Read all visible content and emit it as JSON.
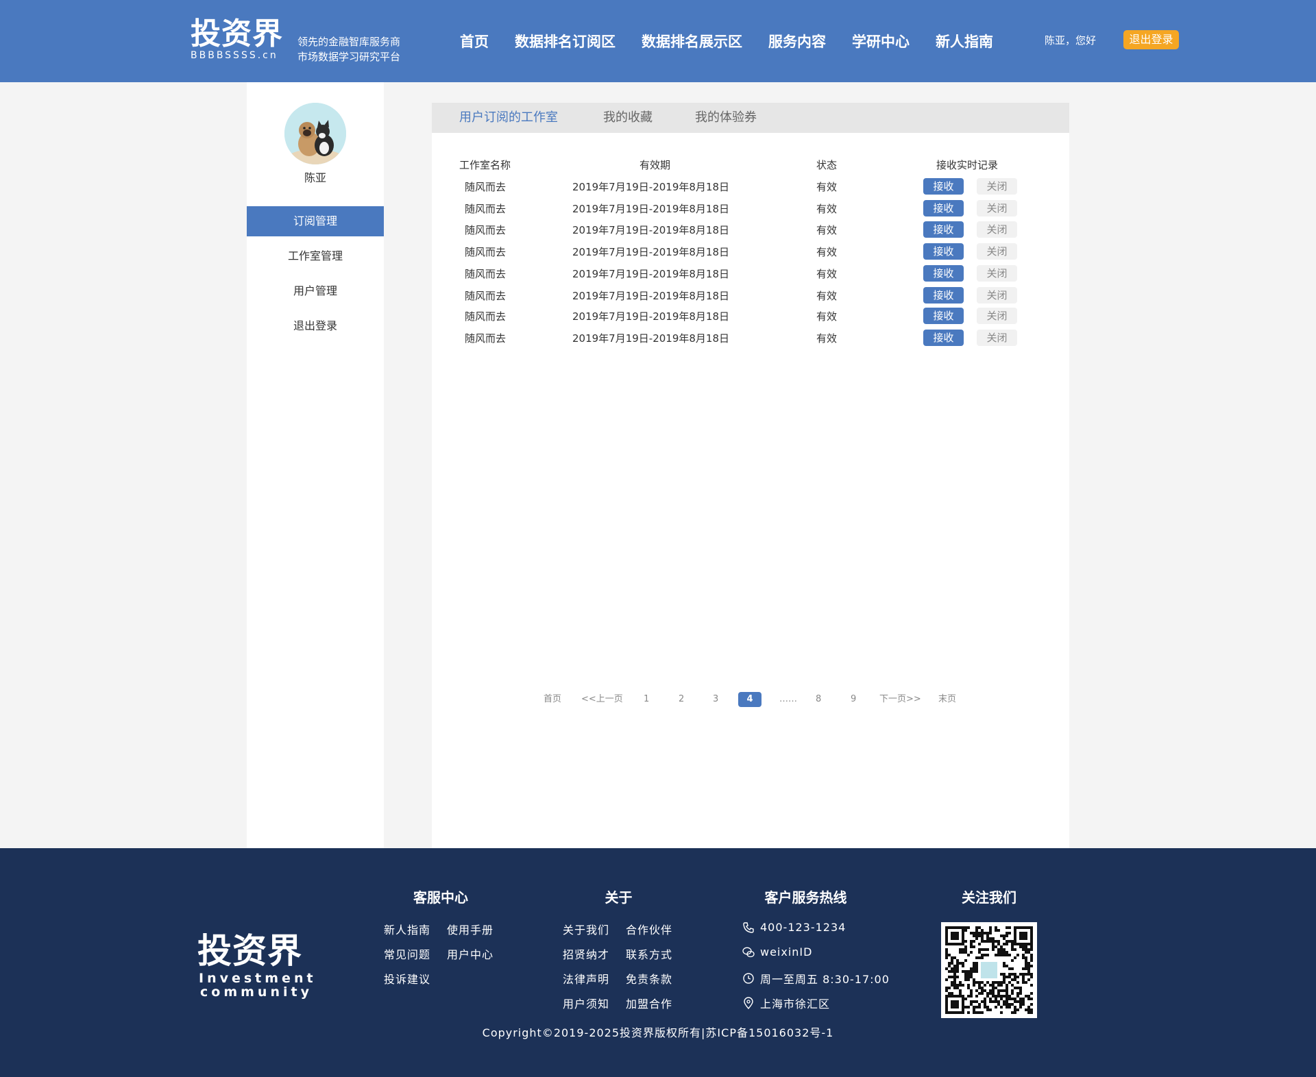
{
  "header": {
    "logo": "投资界",
    "logo_domain": "BBBBSSSS.cn",
    "slogan_line1": "领先的金融智库服务商",
    "slogan_line2": "市场数据学习研究平台",
    "nav": [
      "首页",
      "数据排名订阅区",
      "数据排名展示区",
      "服务内容",
      "学研中心",
      "新人指南"
    ],
    "greeting": "陈亚，您好",
    "logout": "退出登录",
    "colors": {
      "bar": "#4a79bf",
      "logout": "#f5a623"
    }
  },
  "sidebar": {
    "user_name": "陈亚",
    "avatar_icon": "avatar-dog-cat",
    "menu": [
      "订阅管理",
      "工作室管理",
      "用户管理",
      "退出登录"
    ],
    "active_index": 0
  },
  "tabs": [
    "用户订阅的工作室",
    "我的收藏",
    "我的体验券"
  ],
  "table": {
    "headers": [
      "工作室名称",
      "有效期",
      "状态",
      "接收实时记录"
    ],
    "rows": [
      {
        "name": "随风而去",
        "period": "2019年7月19日-2019年8月18日",
        "status": "有效",
        "receive": "接收",
        "close": "关闭"
      },
      {
        "name": "随风而去",
        "period": "2019年7月19日-2019年8月18日",
        "status": "有效",
        "receive": "接收",
        "close": "关闭"
      },
      {
        "name": "随风而去",
        "period": "2019年7月19日-2019年8月18日",
        "status": "有效",
        "receive": "接收",
        "close": "关闭"
      },
      {
        "name": "随风而去",
        "period": "2019年7月19日-2019年8月18日",
        "status": "有效",
        "receive": "接收",
        "close": "关闭"
      },
      {
        "name": "随风而去",
        "period": "2019年7月19日-2019年8月18日",
        "status": "有效",
        "receive": "接收",
        "close": "关闭"
      },
      {
        "name": "随风而去",
        "period": "2019年7月19日-2019年8月18日",
        "status": "有效",
        "receive": "接收",
        "close": "关闭"
      },
      {
        "name": "随风而去",
        "period": "2019年7月19日-2019年8月18日",
        "status": "有效",
        "receive": "接收",
        "close": "关闭"
      },
      {
        "name": "随风而去",
        "period": "2019年7月19日-2019年8月18日",
        "status": "有效",
        "receive": "接收",
        "close": "关闭"
      }
    ]
  },
  "pagination": {
    "first": "首页",
    "prev": "<<上一页",
    "pages": [
      "1",
      "2",
      "3",
      "4",
      "……",
      "8",
      "9"
    ],
    "current": "4",
    "next": "下一页>>",
    "last": "末页"
  },
  "footer": {
    "logo": "投资界",
    "logo_en_line1": "Investment",
    "logo_en_line2": "community",
    "service_title": "客服中心",
    "service_links": [
      "新人指南",
      "使用手册",
      "常见问题",
      "用户中心",
      "投诉建议"
    ],
    "about_title": "关于",
    "about_links": [
      "关于我们",
      "合作伙伴",
      "招贤纳才",
      "联系方式",
      "法律声明",
      "免责条款",
      "用户须知",
      "加盟合作"
    ],
    "hotline_title": "客户服务热线",
    "phone": "400-123-1234",
    "wechat": "weixinID",
    "hours": "周一至周五 8:30-17:00",
    "address": "上海市徐汇区",
    "follow_title": "关注我们",
    "copyright": "Copyright©2019-2025投资界版权所有|苏ICP备15016032号-1",
    "colors": {
      "bg": "#1c3157"
    }
  }
}
